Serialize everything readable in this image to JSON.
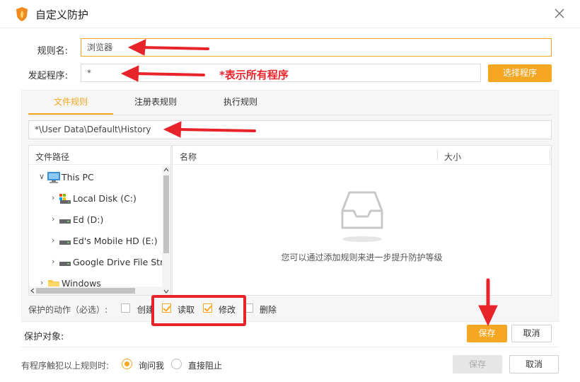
{
  "window": {
    "title": "自定义防护"
  },
  "form": {
    "rule_name_label": "规则名:",
    "rule_name_value": "浏览器",
    "launcher_label": "发起程序:",
    "launcher_value": "*",
    "select_program_button": "选择程序"
  },
  "tabs": [
    {
      "label": "文件规则",
      "active": true
    },
    {
      "label": "注册表规则",
      "active": false
    },
    {
      "label": "执行规则",
      "active": false
    }
  ],
  "path_input": {
    "value": "*\\User Data\\Default\\History"
  },
  "tree": {
    "header": "文件路径",
    "items": [
      {
        "label": "This PC",
        "icon": "computer-icon",
        "expanded": true
      },
      {
        "label": "Local Disk (C:)",
        "icon": "system-drive-icon"
      },
      {
        "label": "Ed (D:)",
        "icon": "drive-icon"
      },
      {
        "label": "Ed's Mobile HD (E:)",
        "icon": "drive-icon"
      },
      {
        "label": "Google Drive File Stre",
        "icon": "drive-icon"
      },
      {
        "label": "Windows",
        "icon": "folder-icon"
      }
    ]
  },
  "list": {
    "col_name": "名称",
    "col_size": "大小",
    "empty_message": "您可以通过添加规则来进一步提升防护等级"
  },
  "actions": {
    "label": "保护的动作（必选）:",
    "items": [
      {
        "label": "创建",
        "checked": false
      },
      {
        "label": "读取",
        "checked": true
      },
      {
        "label": "修改",
        "checked": true
      },
      {
        "label": "删除",
        "checked": false
      }
    ]
  },
  "inner_buttons": {
    "save": "保存",
    "cancel": "取消"
  },
  "protect_target_label": "保护对象:",
  "trigger": {
    "label": "有程序触犯以上规则时:",
    "options": [
      {
        "label": "询问我",
        "selected": true
      },
      {
        "label": "直接阻止",
        "selected": false
      }
    ]
  },
  "footer_buttons": {
    "save": "保存",
    "cancel": "取消"
  },
  "annotation": {
    "text": "*表示所有程序"
  },
  "colors": {
    "accent": "#f5a623",
    "annotation_red": "#e8242b"
  }
}
